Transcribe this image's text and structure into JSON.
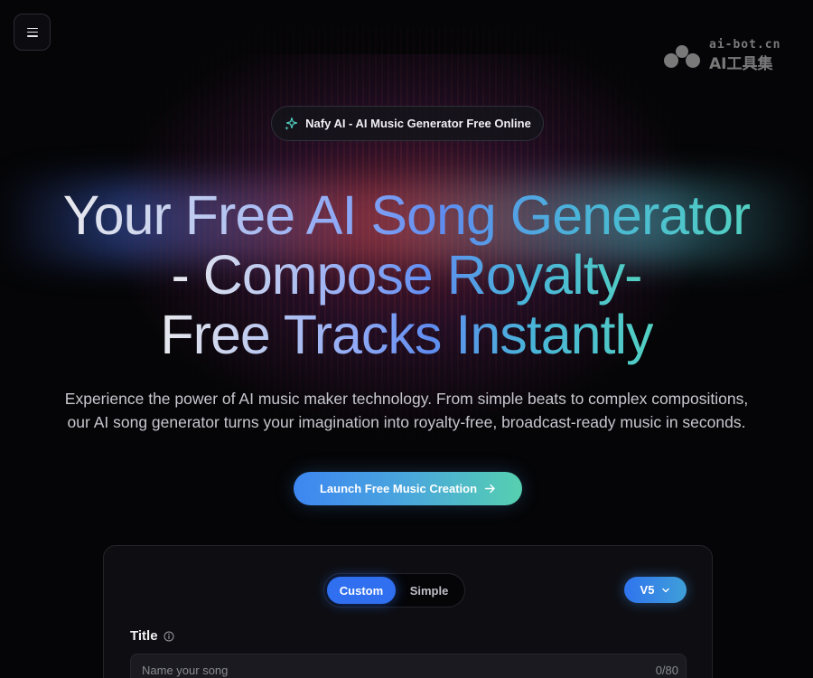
{
  "menu": {
    "icon": "hamburger-menu-icon"
  },
  "watermark": {
    "top": "ai-bot.cn",
    "bottom": "AI工具集"
  },
  "badge": {
    "icon": "sparkle-icon",
    "text": "Nafy AI - AI Music Generator Free Online"
  },
  "hero": {
    "headline_line1": "Your Free AI Song Generator",
    "headline_line2": "- Compose Royalty-",
    "headline_line3": "Free Tracks Instantly",
    "subtitle_line1": "Experience the power of AI music maker technology. From simple beats to complex compositions,",
    "subtitle_line2": "our AI song generator turns your imagination into royalty-free, broadcast-ready music in seconds.",
    "cta_label": "Launch Free Music Creation",
    "cta_icon": "arrow-right-icon"
  },
  "creator": {
    "modes": [
      {
        "label": "Custom",
        "active": true
      },
      {
        "label": "Simple",
        "active": false
      }
    ],
    "version": "V5",
    "version_icon": "chevron-down-icon",
    "title_label": "Title",
    "title_info_icon": "info-icon",
    "title_placeholder": "Name your song",
    "title_counter": "0/80"
  },
  "colors": {
    "accent_blue": "#2f6ff0",
    "accent_teal": "#56d0b0",
    "background": "#050507",
    "card": "#0e0e12"
  }
}
